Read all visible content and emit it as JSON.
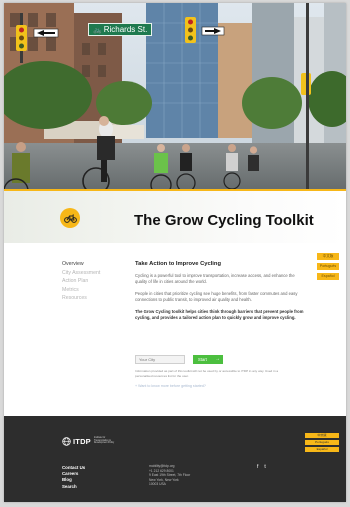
{
  "hero": {
    "street_sign": "Richards St."
  },
  "page": {
    "title": "The Grow Cycling Toolkit"
  },
  "sidenav": {
    "items": [
      {
        "label": "Overview",
        "active": true
      },
      {
        "label": "City Assessment",
        "active": false
      },
      {
        "label": "Action Plan",
        "active": false
      },
      {
        "label": "Metrics",
        "active": false
      },
      {
        "label": "Resources",
        "active": false
      }
    ]
  },
  "main": {
    "heading": "Take Action to Improve Cycling",
    "para1": "Cycling is a powerful tool to improve transportation, increase access, and enhance the quality of life in cities around the world.",
    "para2": "People in cities that prioritize cycling see huge benefits, from faster commutes and easy connections to public transit, to improved air quality and health.",
    "para3": "The Grow Cycling toolkit helps cities think through barriers that prevent people from cycling, and provides a tailored action plan to quickly grow and improve cycling.",
    "city_placeholder": "Your City",
    "start_label": "Start",
    "disclaimer": "Information provided as part of this toolkit will not be used by or accessible to ITDP in any way. Used in a personalised resources list for the user.",
    "learn_more": "+ Want to know more before getting started?"
  },
  "languages": {
    "items": [
      "中文版",
      "Português",
      "Español"
    ]
  },
  "footer": {
    "logo_text": "ITDP",
    "logo_tagline": "Institute for Transportation & Development Policy",
    "nav": [
      "Contact Us",
      "Careers",
      "Blog",
      "Search"
    ],
    "contact": [
      "mobility@itdp.org",
      "+1 212 629 8001",
      "9 East 19th Street, 7th Floor",
      "New York, New York",
      "10003 USA"
    ],
    "social": [
      "f",
      "t"
    ],
    "languages": [
      "中文版",
      "Português",
      "Español"
    ]
  },
  "colors": {
    "accent": "#f7b718",
    "start_green": "#4cbf3f",
    "footer_bg": "#2d2d2d",
    "street_sign": "#1f7a4f"
  }
}
